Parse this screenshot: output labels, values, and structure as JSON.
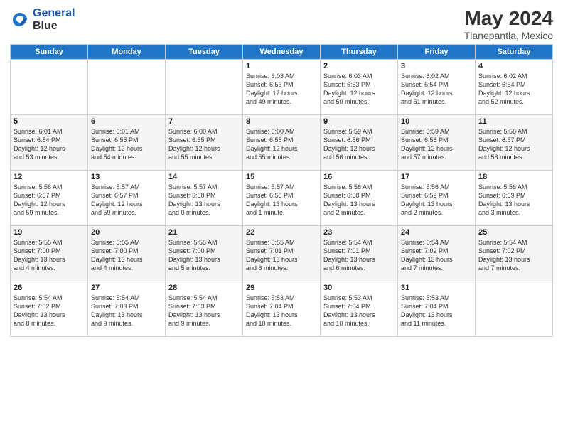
{
  "header": {
    "logo_line1": "General",
    "logo_line2": "Blue",
    "main_title": "May 2024",
    "subtitle": "Tlanepantla, Mexico"
  },
  "days_of_week": [
    "Sunday",
    "Monday",
    "Tuesday",
    "Wednesday",
    "Thursday",
    "Friday",
    "Saturday"
  ],
  "weeks": [
    [
      {
        "day": "",
        "text": ""
      },
      {
        "day": "",
        "text": ""
      },
      {
        "day": "",
        "text": ""
      },
      {
        "day": "1",
        "text": "Sunrise: 6:03 AM\nSunset: 6:53 PM\nDaylight: 12 hours\nand 49 minutes."
      },
      {
        "day": "2",
        "text": "Sunrise: 6:03 AM\nSunset: 6:53 PM\nDaylight: 12 hours\nand 50 minutes."
      },
      {
        "day": "3",
        "text": "Sunrise: 6:02 AM\nSunset: 6:54 PM\nDaylight: 12 hours\nand 51 minutes."
      },
      {
        "day": "4",
        "text": "Sunrise: 6:02 AM\nSunset: 6:54 PM\nDaylight: 12 hours\nand 52 minutes."
      }
    ],
    [
      {
        "day": "5",
        "text": "Sunrise: 6:01 AM\nSunset: 6:54 PM\nDaylight: 12 hours\nand 53 minutes."
      },
      {
        "day": "6",
        "text": "Sunrise: 6:01 AM\nSunset: 6:55 PM\nDaylight: 12 hours\nand 54 minutes."
      },
      {
        "day": "7",
        "text": "Sunrise: 6:00 AM\nSunset: 6:55 PM\nDaylight: 12 hours\nand 55 minutes."
      },
      {
        "day": "8",
        "text": "Sunrise: 6:00 AM\nSunset: 6:55 PM\nDaylight: 12 hours\nand 55 minutes."
      },
      {
        "day": "9",
        "text": "Sunrise: 5:59 AM\nSunset: 6:56 PM\nDaylight: 12 hours\nand 56 minutes."
      },
      {
        "day": "10",
        "text": "Sunrise: 5:59 AM\nSunset: 6:56 PM\nDaylight: 12 hours\nand 57 minutes."
      },
      {
        "day": "11",
        "text": "Sunrise: 5:58 AM\nSunset: 6:57 PM\nDaylight: 12 hours\nand 58 minutes."
      }
    ],
    [
      {
        "day": "12",
        "text": "Sunrise: 5:58 AM\nSunset: 6:57 PM\nDaylight: 12 hours\nand 59 minutes."
      },
      {
        "day": "13",
        "text": "Sunrise: 5:57 AM\nSunset: 6:57 PM\nDaylight: 12 hours\nand 59 minutes."
      },
      {
        "day": "14",
        "text": "Sunrise: 5:57 AM\nSunset: 6:58 PM\nDaylight: 13 hours\nand 0 minutes."
      },
      {
        "day": "15",
        "text": "Sunrise: 5:57 AM\nSunset: 6:58 PM\nDaylight: 13 hours\nand 1 minute."
      },
      {
        "day": "16",
        "text": "Sunrise: 5:56 AM\nSunset: 6:58 PM\nDaylight: 13 hours\nand 2 minutes."
      },
      {
        "day": "17",
        "text": "Sunrise: 5:56 AM\nSunset: 6:59 PM\nDaylight: 13 hours\nand 2 minutes."
      },
      {
        "day": "18",
        "text": "Sunrise: 5:56 AM\nSunset: 6:59 PM\nDaylight: 13 hours\nand 3 minutes."
      }
    ],
    [
      {
        "day": "19",
        "text": "Sunrise: 5:55 AM\nSunset: 7:00 PM\nDaylight: 13 hours\nand 4 minutes."
      },
      {
        "day": "20",
        "text": "Sunrise: 5:55 AM\nSunset: 7:00 PM\nDaylight: 13 hours\nand 4 minutes."
      },
      {
        "day": "21",
        "text": "Sunrise: 5:55 AM\nSunset: 7:00 PM\nDaylight: 13 hours\nand 5 minutes."
      },
      {
        "day": "22",
        "text": "Sunrise: 5:55 AM\nSunset: 7:01 PM\nDaylight: 13 hours\nand 6 minutes."
      },
      {
        "day": "23",
        "text": "Sunrise: 5:54 AM\nSunset: 7:01 PM\nDaylight: 13 hours\nand 6 minutes."
      },
      {
        "day": "24",
        "text": "Sunrise: 5:54 AM\nSunset: 7:02 PM\nDaylight: 13 hours\nand 7 minutes."
      },
      {
        "day": "25",
        "text": "Sunrise: 5:54 AM\nSunset: 7:02 PM\nDaylight: 13 hours\nand 7 minutes."
      }
    ],
    [
      {
        "day": "26",
        "text": "Sunrise: 5:54 AM\nSunset: 7:02 PM\nDaylight: 13 hours\nand 8 minutes."
      },
      {
        "day": "27",
        "text": "Sunrise: 5:54 AM\nSunset: 7:03 PM\nDaylight: 13 hours\nand 9 minutes."
      },
      {
        "day": "28",
        "text": "Sunrise: 5:54 AM\nSunset: 7:03 PM\nDaylight: 13 hours\nand 9 minutes."
      },
      {
        "day": "29",
        "text": "Sunrise: 5:53 AM\nSunset: 7:04 PM\nDaylight: 13 hours\nand 10 minutes."
      },
      {
        "day": "30",
        "text": "Sunrise: 5:53 AM\nSunset: 7:04 PM\nDaylight: 13 hours\nand 10 minutes."
      },
      {
        "day": "31",
        "text": "Sunrise: 5:53 AM\nSunset: 7:04 PM\nDaylight: 13 hours\nand 11 minutes."
      },
      {
        "day": "",
        "text": ""
      }
    ]
  ]
}
